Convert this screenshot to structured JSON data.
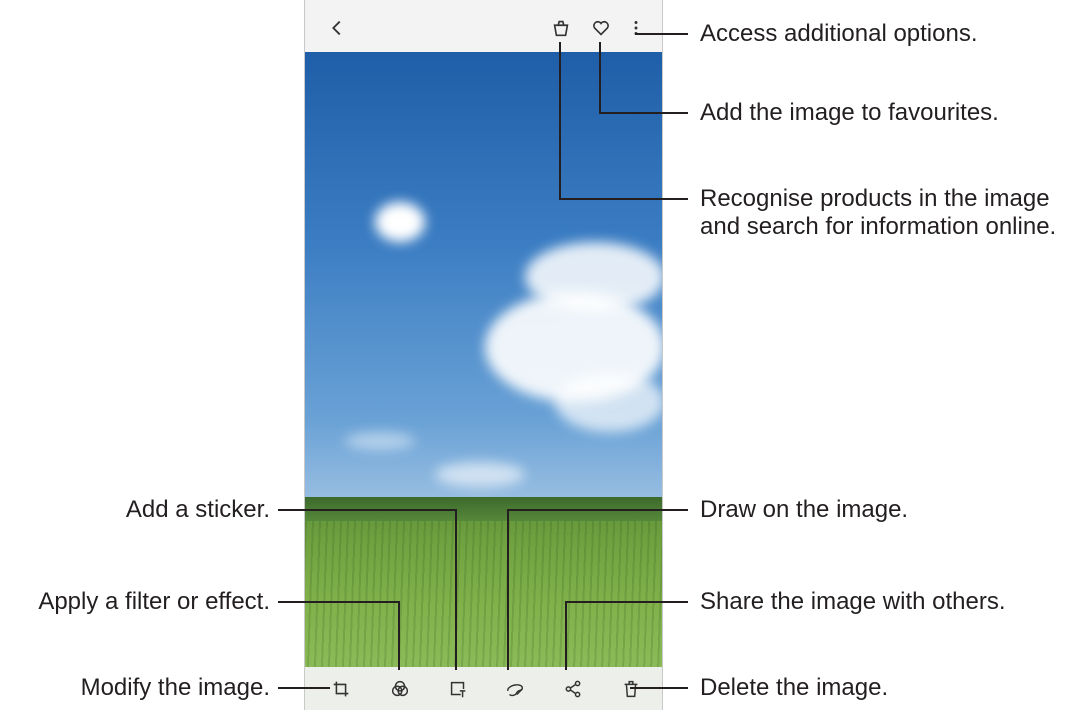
{
  "toolbar": {
    "back_icon": "chevron-left-icon",
    "product_icon": "bag-icon",
    "favourite_icon": "heart-icon",
    "more_icon": "more-vertical-icon"
  },
  "bottom_toolbar": {
    "icons": [
      "crop-rotate-icon",
      "filter-effect-icon",
      "sticker-icon",
      "draw-icon",
      "share-icon",
      "trash-icon"
    ]
  },
  "callouts": {
    "more_options": "Access additional options.",
    "favourites": "Add the image to favourites.",
    "recognise": "Recognise products in the image and search for information online.",
    "sticker": "Add a sticker.",
    "draw": "Draw on the image.",
    "filter": "Apply a filter or effect.",
    "share": "Share the image with others.",
    "modify": "Modify the image.",
    "delete": "Delete the image."
  }
}
